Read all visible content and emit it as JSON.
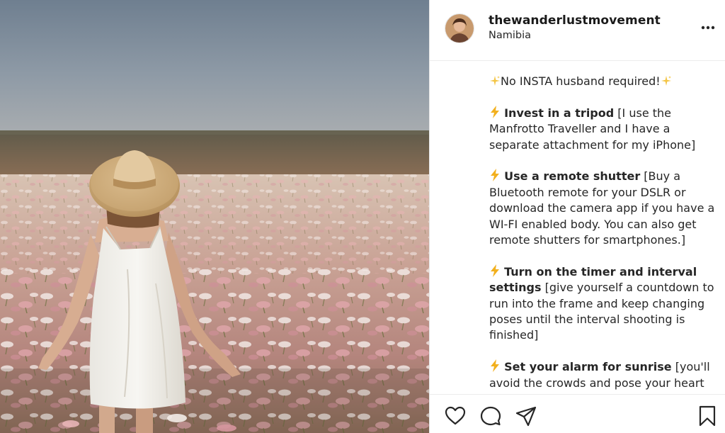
{
  "post": {
    "account": {
      "username": "thewanderlustmovement",
      "location": "Namibia"
    },
    "caption": {
      "intro": "No INSTA husband required!",
      "tips": [
        {
          "title": "Invest in a tripod",
          "text": " [I use the Manfrotto Traveller and I have a separate attachment for my iPhone]"
        },
        {
          "title": "Use a remote shutter",
          "text": " [Buy a Bluetooth remote for your DSLR or download the camera app if you have a WI-FI enabled body. You can also get remote shutters for smartphones.]"
        },
        {
          "title": "Turn on the timer and interval settings",
          "text": " [give yourself a countdown to run into the frame and keep changing poses until the interval shooting is finished]"
        },
        {
          "title": "Set your alarm for sunrise",
          "text": " [you'll avoid the crowds and pose your heart out without the awkward stares PLUS"
        }
      ]
    },
    "icons": {
      "more": "more-options-icon",
      "like": "heart-icon",
      "comment": "comment-icon",
      "share": "paper-plane-icon",
      "save": "bookmark-icon",
      "sparkle": "sparkles-icon",
      "bolt": "lightning-icon"
    },
    "colors": {
      "text": "#262626",
      "sparkle": "#f4c545",
      "bolt": "#f2b01e"
    }
  }
}
